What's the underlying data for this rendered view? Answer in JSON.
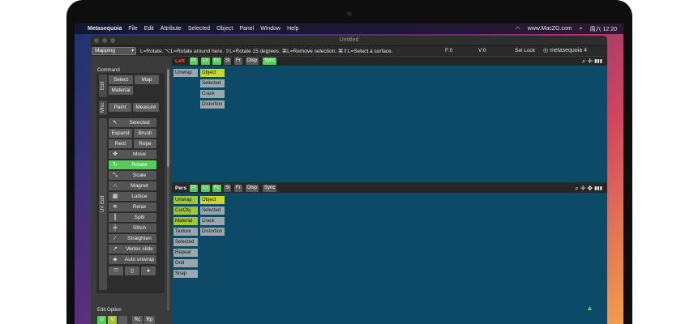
{
  "menubar": {
    "items": [
      "Metasequoia",
      "File",
      "Edit",
      "Attribute",
      "Selected",
      "Object",
      "Panel",
      "Window",
      "Help"
    ],
    "url": "www.MacZG.com",
    "clock": "周六 12:20"
  },
  "window": {
    "title": "Untitled"
  },
  "toolbar": {
    "mode": "Mapping",
    "hint": "L=Rotate.  ⌥L=Rotate around here.  ⇧L=Rotate 15 degrees.  ⌘L=Remove selection.  ⌘⇧L=Select a surface.",
    "faces": "F:0",
    "vertices": "V:0",
    "sel_lock": "Sel Lock",
    "logo": "metasequoia 4"
  },
  "left_panel": {
    "command_title": "Command",
    "edit_tab": "Edit",
    "misc_tab": "Misc",
    "uv_tab": "UV Edit",
    "edit_buttons": [
      "Select",
      "Map",
      "Material"
    ],
    "misc_buttons": [
      "Paint",
      "Measure"
    ],
    "uv_tools": [
      {
        "icon": "arrow-icon",
        "glyph": "↖",
        "label": "Selected",
        "active": false
      },
      {
        "icon": "expand-icon",
        "glyph": "",
        "label": "Expand",
        "active": false,
        "label2": "Brush"
      },
      {
        "icon": "rect-icon",
        "glyph": "",
        "label": "Rect",
        "active": false,
        "label2": "Rope"
      },
      {
        "icon": "move-icon",
        "glyph": "✥",
        "label": "Move",
        "active": false
      },
      {
        "icon": "rotate-icon",
        "glyph": "↻",
        "label": "Rotate",
        "active": true
      },
      {
        "icon": "scale-icon",
        "glyph": "⤡",
        "label": "Scale",
        "active": false
      },
      {
        "icon": "magnet-icon",
        "glyph": "∩",
        "label": "Magnet",
        "active": false
      },
      {
        "icon": "lattice-icon",
        "glyph": "▦",
        "label": "Lattice",
        "active": false
      },
      {
        "icon": "relax-icon",
        "glyph": "≋",
        "label": "Relax",
        "active": false
      },
      {
        "icon": "split-icon",
        "glyph": "║",
        "label": "Split",
        "active": false
      },
      {
        "icon": "stitch-icon",
        "glyph": "╪",
        "label": "Stitch",
        "active": false
      },
      {
        "icon": "straighten-icon",
        "glyph": "∕",
        "label": "Straighten",
        "active": false
      },
      {
        "icon": "vertex-slide-icon",
        "glyph": "↗",
        "label": "Vertex slide",
        "active": false
      },
      {
        "icon": "auto-unwrap-icon",
        "glyph": "◈",
        "label": "Auto unwrap",
        "active": false
      }
    ],
    "edit_option_title": "Edit Option",
    "edit_options_row1": [
      "U",
      "V",
      "",
      "Rc",
      "Rp"
    ],
    "edit_options_row2": [
      "L",
      "W",
      "S"
    ]
  },
  "top_viewport": {
    "name": "Left",
    "chips": [
      "Pt",
      "Ln",
      "Fc",
      "Sl",
      "Fr",
      "Disp",
      "Sync"
    ],
    "buttons": [
      "Unwrap",
      "Object",
      "Selected",
      "Crack",
      "Distortion"
    ]
  },
  "bottom_viewport": {
    "name": "Pers",
    "chips": [
      "Pt",
      "Ln",
      "Fc",
      "Sl",
      "Fr",
      "Disp",
      "Sync"
    ],
    "buttons_left": [
      "Unwrap",
      "CurObj",
      "Material",
      "Texture",
      "Selected",
      "Repeat",
      "Grid",
      "Snap"
    ],
    "buttons_right": [
      "Object",
      "Selected",
      "Crack",
      "Distortion"
    ]
  },
  "colors": {
    "viewport_bg": "#0d4a68",
    "active_green": "#5ac85a",
    "highlight_yellow": "#c8d62e"
  }
}
